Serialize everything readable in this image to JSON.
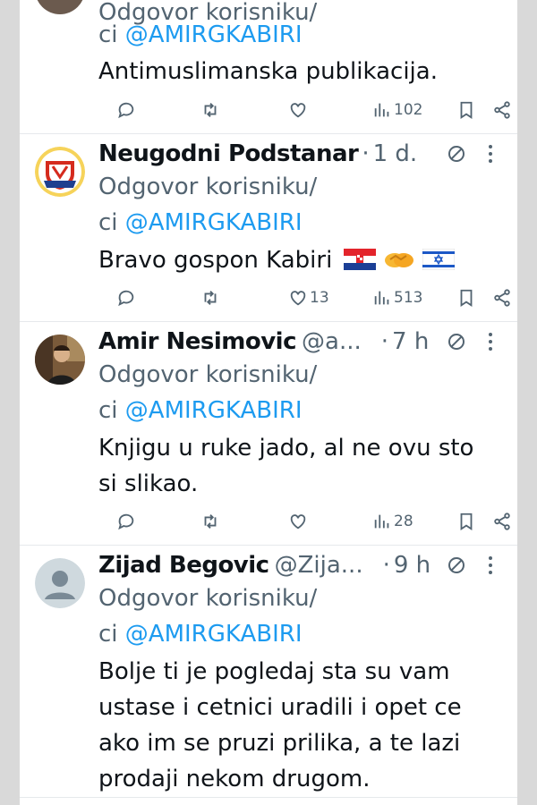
{
  "tweets": [
    {
      "name": "",
      "handle": "",
      "time": "",
      "reply_prefix": "Odgovor korisniku/",
      "reply_to_prefix": "ci",
      "reply_to": "@AMIRGKABIRI",
      "text_lines": [
        "Antimuslimanska publikacija."
      ],
      "stats": {
        "replies": "",
        "retweets": "",
        "likes": "",
        "views": "102"
      },
      "avatar": "partial-avatar"
    },
    {
      "name": "Neugodni Podstanar",
      "handle": "",
      "time": "1 d.",
      "reply_prefix": "Odgovor korisniku/",
      "reply_to_prefix": "ci",
      "reply_to": "@AMIRGKABIRI",
      "text_lines": [
        "Bravo gospon Kabiri"
      ],
      "emoji": [
        "croatia-flag",
        "handshake",
        "israel-flag"
      ],
      "stats": {
        "replies": "",
        "retweets": "",
        "likes": "13",
        "views": "513"
      },
      "avatar": "club-crest-avatar"
    },
    {
      "name": "Amir Nesimovic",
      "handle": "@a...",
      "time": "7 h",
      "reply_prefix": "Odgovor korisniku/",
      "reply_to_prefix": "ci",
      "reply_to": "@AMIRGKABIRI",
      "text_lines": [
        "Knjigu u ruke jado, al ne ovu sto",
        "si slikao."
      ],
      "stats": {
        "replies": "",
        "retweets": "",
        "likes": "",
        "views": "28"
      },
      "avatar": "photo-avatar"
    },
    {
      "name": "Zijad Begovic",
      "handle": "@Zija...",
      "time": "9 h",
      "reply_prefix": "Odgovor korisniku/",
      "reply_to_prefix": "ci",
      "reply_to": "@AMIRGKABIRI",
      "text_lines": [
        "Bolje ti je pogledaj sta su vam",
        "ustase i cetnici uradili i opet ce",
        "ako im se pruzi prilika, a te lazi",
        "prodaji nekom drugom."
      ],
      "avatar": "default-avatar"
    }
  ],
  "separator": "·",
  "colors": {
    "accent": "#1d9bf0",
    "secondary_text": "#536471",
    "primary_text": "#0f1419",
    "divider": "#e6e9ec",
    "page_margin": "#d9d9d9"
  },
  "icons": [
    "reply-icon",
    "retweet-icon",
    "like-icon",
    "views-icon",
    "bookmark-icon",
    "share-icon",
    "mute-icon",
    "more-icon"
  ]
}
